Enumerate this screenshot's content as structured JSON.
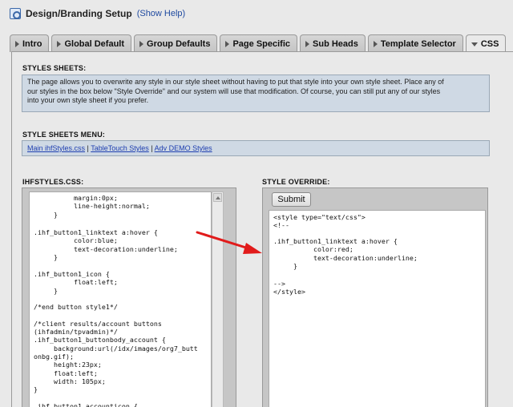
{
  "header": {
    "title": "Design/Branding Setup",
    "help": "(Show Help)"
  },
  "tabs": [
    {
      "label": "Intro"
    },
    {
      "label": "Global Default"
    },
    {
      "label": "Group Defaults"
    },
    {
      "label": "Page Specific"
    },
    {
      "label": "Sub Heads"
    },
    {
      "label": "Template Selector"
    },
    {
      "label": "CSS",
      "active": true
    }
  ],
  "stylesheets": {
    "title": "STYLES SHEETS:",
    "line1": "The page allows you to overwrite any style in our style sheet without having to put that style into your own style sheet. Place any of",
    "line2": "our styles in the box below \"Style Override\" and our system will use that modification.  Of course, you can still put any of our styles",
    "line3": "into your own style sheet if you prefer."
  },
  "menu": {
    "title": "STYLE SHEETS MENU:",
    "links": [
      "Main ihfStyles.css",
      "TableTouch Styles",
      "Adv DEMO Styles"
    ],
    "separator": " | "
  },
  "css_box": {
    "title": "IHFSTYLES.CSS:",
    "code_top": "          margin:0px;\n          line-height:normal;\n     }",
    "code_highlight": ".ihf_button1_linktext a:hover {\n          color:blue;\n          text-decoration:underline;\n     }",
    "code_rest": ".ihf_button1_icon {\n          float:left;\n     }\n\n/*end button style1*/\n\n/*client results/account buttons\n(ihfadmin/tpvadmin)*/\n.ihf_button1_buttonbody_account {\n     background:url(/idx/images/org7_butt\nonbg.gif);\n     height:23px;\n     float:left;\n     width: 105px;\n}\n\n.ihf_button1_accounticon {"
  },
  "override": {
    "title": "STYLE OVERRIDE:",
    "submit_label": "Submit",
    "code_top": "<style type=\"text/css\">\n<!--",
    "code_highlight": ".ihf_button1_linktext a:hover {\n          color:red;\n          text-decoration:underline;\n     }",
    "code_bottom": "-->\n</style>"
  },
  "colors": {
    "arrow": "#e11b1b",
    "info_bg": "#cfd9e4",
    "link": "#1f3fb0"
  }
}
